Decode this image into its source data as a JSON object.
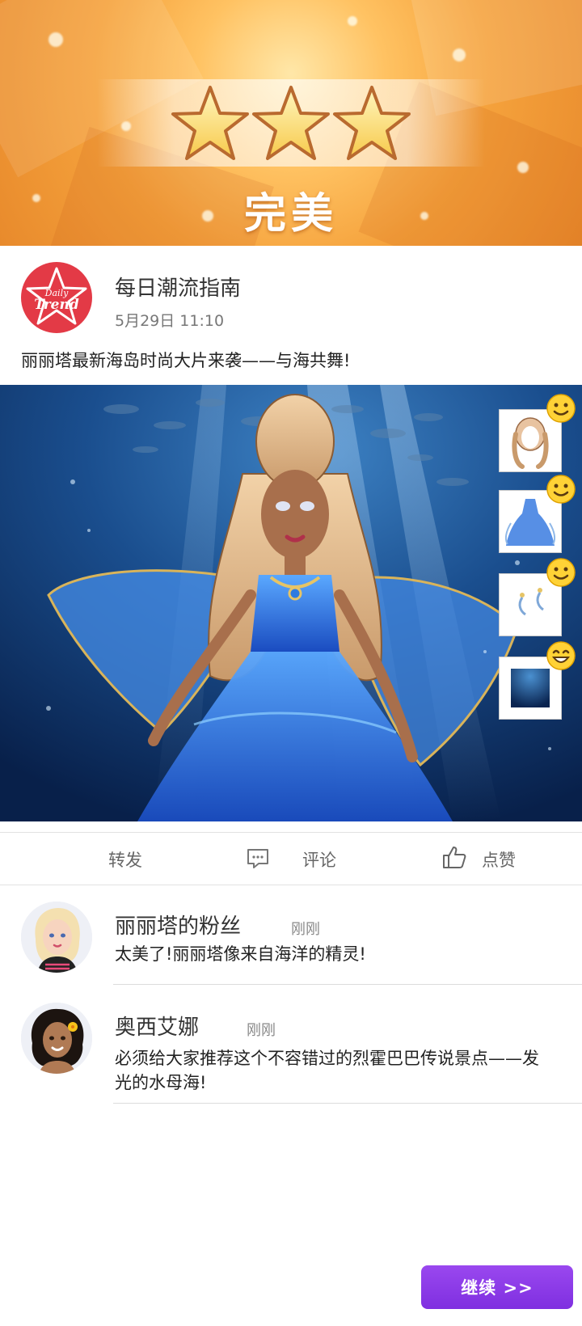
{
  "result": {
    "rating_label": "完美",
    "stars": 3
  },
  "post": {
    "author": "每日潮流指南",
    "brand_logo_text": "Daily Trend",
    "date": "5月29日 11:10",
    "caption": "丽丽塔最新海岛时尚大片来袭——与海共舞!"
  },
  "outfit_items": [
    {
      "icon": "hairstyle-icon",
      "reaction": "smile-emoji"
    },
    {
      "icon": "dress-icon",
      "reaction": "smile-emoji"
    },
    {
      "icon": "earrings-icon",
      "reaction": "smile-emoji"
    },
    {
      "icon": "background-icon",
      "reaction": "grin-emoji"
    }
  ],
  "actions": {
    "share": "转发",
    "comment": "评论",
    "like": "点赞"
  },
  "comments": [
    {
      "name": "丽丽塔的粉丝",
      "time": "刚刚",
      "text": "太美了!丽丽塔像来自海洋的精灵!"
    },
    {
      "name": "奥西艾娜",
      "time": "刚刚",
      "text": "必须给大家推荐这个不容错过的烈霍巴巴传说景点——发光的水母海!"
    }
  ],
  "continue_button": "继续 >>",
  "colors": {
    "accent_purple": "#8a3ae6",
    "brand_red": "#e33a46",
    "banner_orange": "#f5a23c",
    "ocean_blue": "#0c2a5a"
  }
}
